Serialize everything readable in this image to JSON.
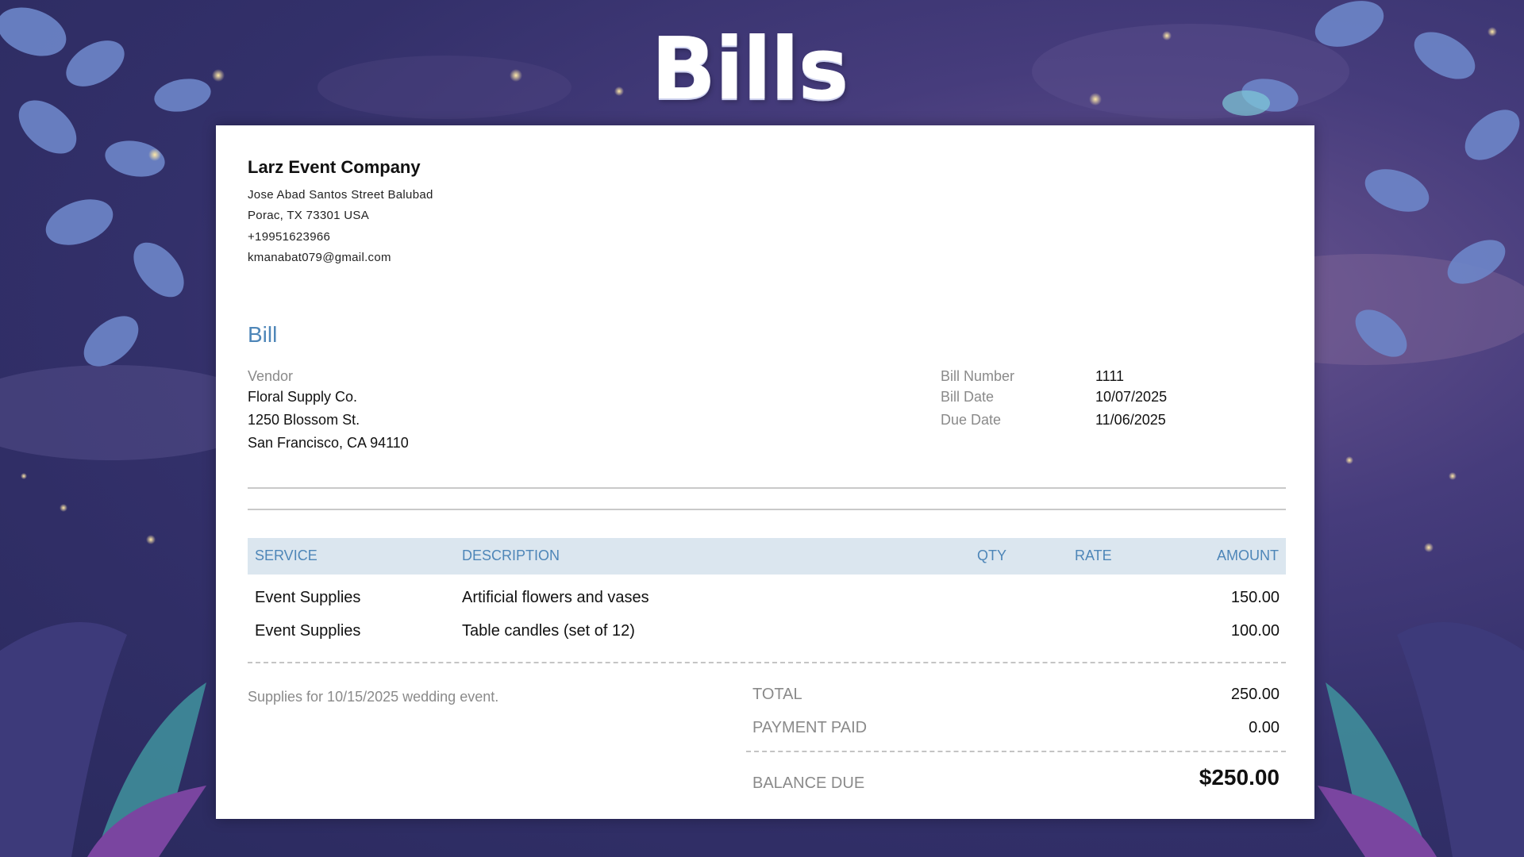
{
  "banner": {
    "title": "Bills"
  },
  "company": {
    "name": "Larz Event Company",
    "address_line1": "Jose Abad Santos Street Balubad",
    "address_line2": "Porac, TX  73301 USA",
    "phone": "+19951623966",
    "email": "kmanabat079@gmail.com"
  },
  "document": {
    "title": "Bill"
  },
  "vendor": {
    "label": "Vendor",
    "name": "Floral Supply Co.",
    "street": "1250 Blossom St.",
    "city": "San Francisco, CA 94110"
  },
  "meta": [
    {
      "label": "Bill Number",
      "value": "1111"
    },
    {
      "label": "Bill Date",
      "value": "10/07/2025"
    },
    {
      "label": "Due Date",
      "value": "11/06/2025"
    }
  ],
  "table": {
    "headers": {
      "service": "SERVICE",
      "description": "DESCRIPTION",
      "qty": "QTY",
      "rate": "RATE",
      "amount": "AMOUNT"
    },
    "rows": [
      {
        "service": "Event Supplies",
        "description": "Artificial flowers and vases",
        "qty": "",
        "rate": "",
        "amount": "150.00"
      },
      {
        "service": "Event Supplies",
        "description": "Table candles (set of 12)",
        "qty": "",
        "rate": "",
        "amount": "100.00"
      }
    ]
  },
  "note": "Supplies for 10/15/2025 wedding event.",
  "summary": {
    "total_label": "TOTAL",
    "total_value": "250.00",
    "paid_label": "PAYMENT PAID",
    "paid_value": "0.00",
    "balance_label": "BALANCE DUE",
    "balance_value": "$250.00"
  },
  "colors": {
    "accent": "#4e86b8",
    "header_fill": "#dbe6ef",
    "background": "#33306a"
  }
}
